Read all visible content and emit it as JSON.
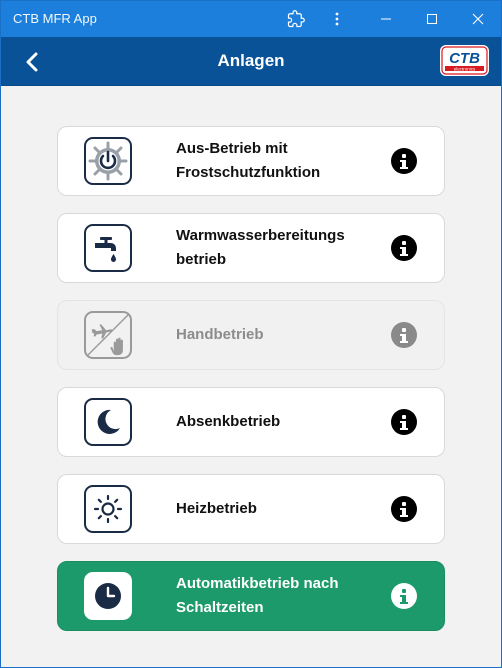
{
  "window": {
    "title": "CTB MFR App",
    "buttons": [
      "extension-icon",
      "more-vert-icon",
      "minimize-icon",
      "maximize-icon",
      "close-icon"
    ]
  },
  "header": {
    "title": "Anlagen",
    "back_icon": "chevron-left-icon",
    "logo_text": "CTB",
    "logo_subtext": "electronics",
    "colors": {
      "titlebar": "#1c7fdc",
      "appbar": "#0a5298",
      "logo_red": "#d71920",
      "logo_blue": "#0a5298"
    }
  },
  "modes": [
    {
      "label_line1": "Aus-Betrieb mit",
      "label_line2": "Frostschutzfunktion",
      "icon": "power-snowflake-icon",
      "state": "normal"
    },
    {
      "label_line1": "Warmwasserbereitungs",
      "label_line2": "betrieb",
      "icon": "tap-icon",
      "state": "normal"
    },
    {
      "label_line1": "Handbetrieb",
      "label_line2": "",
      "icon": "plane-hand-icon",
      "state": "disabled"
    },
    {
      "label_line1": "Absenkbetrieb",
      "label_line2": "",
      "icon": "moon-icon",
      "state": "normal"
    },
    {
      "label_line1": "Heizbetrieb",
      "label_line2": "",
      "icon": "sun-icon",
      "state": "normal"
    },
    {
      "label_line1": "Automatikbetrieb nach",
      "label_line2": "Schaltzeiten",
      "icon": "clock-icon",
      "state": "active"
    }
  ],
  "colors": {
    "active_bg": "#1d9a6c",
    "icon_dark": "#1a2b45"
  }
}
